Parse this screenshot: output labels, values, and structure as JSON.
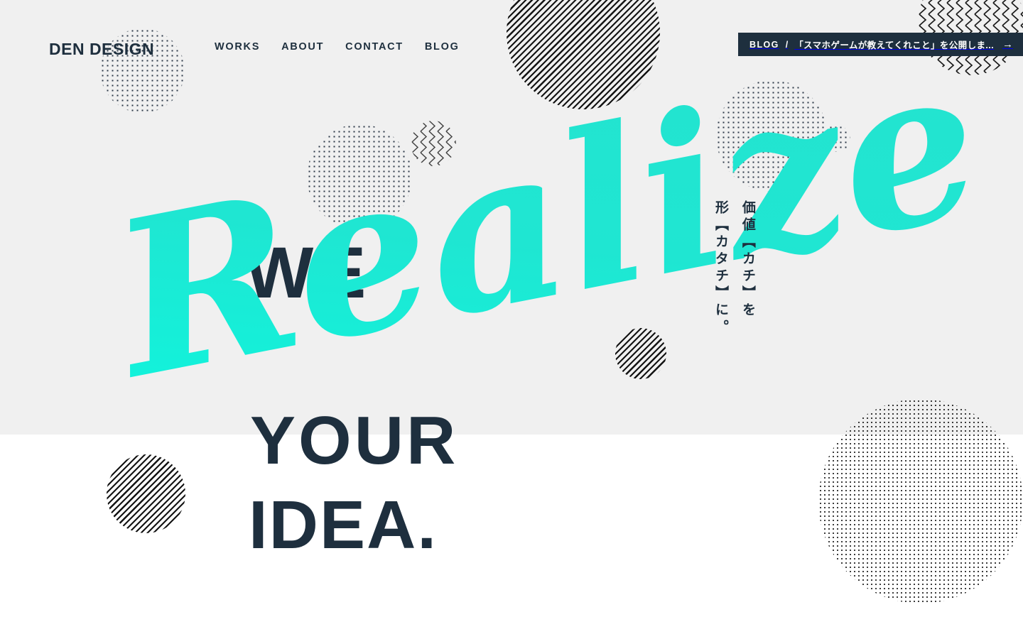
{
  "site": {
    "logo": "DEN DESIGN",
    "background_top_color": "#f0f0f0",
    "background_bottom_color": "#ffffff",
    "ink_color": "#1e2f3e",
    "accent_color": "#1fe6d2"
  },
  "nav": {
    "items": [
      {
        "label": "WORKS"
      },
      {
        "label": "ABOUT"
      },
      {
        "label": "CONTACT"
      },
      {
        "label": "BLOG"
      }
    ]
  },
  "blog_ticker": {
    "category": "BLOG",
    "separator": "/",
    "title": "「スマホゲームが教えてくれこと」を公開しま...",
    "arrow": "→"
  },
  "hero": {
    "line1": "WE",
    "script": "Realize",
    "line2": "YOUR",
    "line3": "IDEA.",
    "tagline_right": "価値【カチ】を",
    "tagline_left": "形【カタチ】に。"
  }
}
